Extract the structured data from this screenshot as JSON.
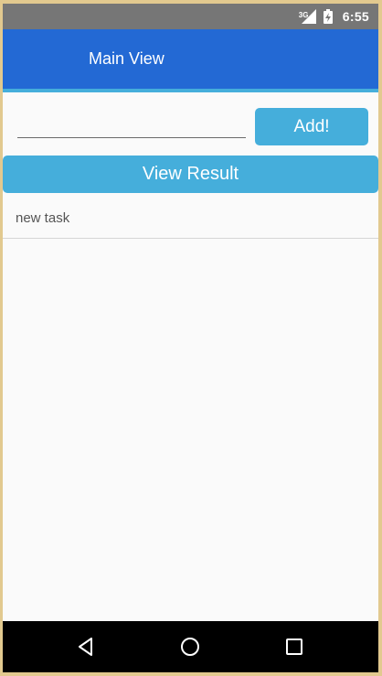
{
  "status_bar": {
    "network": "3G",
    "time": "6:55",
    "icons": [
      "signal-icon",
      "battery-charging-icon"
    ]
  },
  "app_bar": {
    "title": "Main View",
    "color": "#2369d4",
    "accent_color": "#45aedb"
  },
  "form": {
    "input_value": "",
    "add_label": "Add!",
    "view_result_label": "View Result"
  },
  "tasks": [
    {
      "label": "new task"
    }
  ],
  "nav_bar": {
    "icons": [
      "back-icon",
      "home-icon",
      "recent-apps-icon"
    ]
  }
}
